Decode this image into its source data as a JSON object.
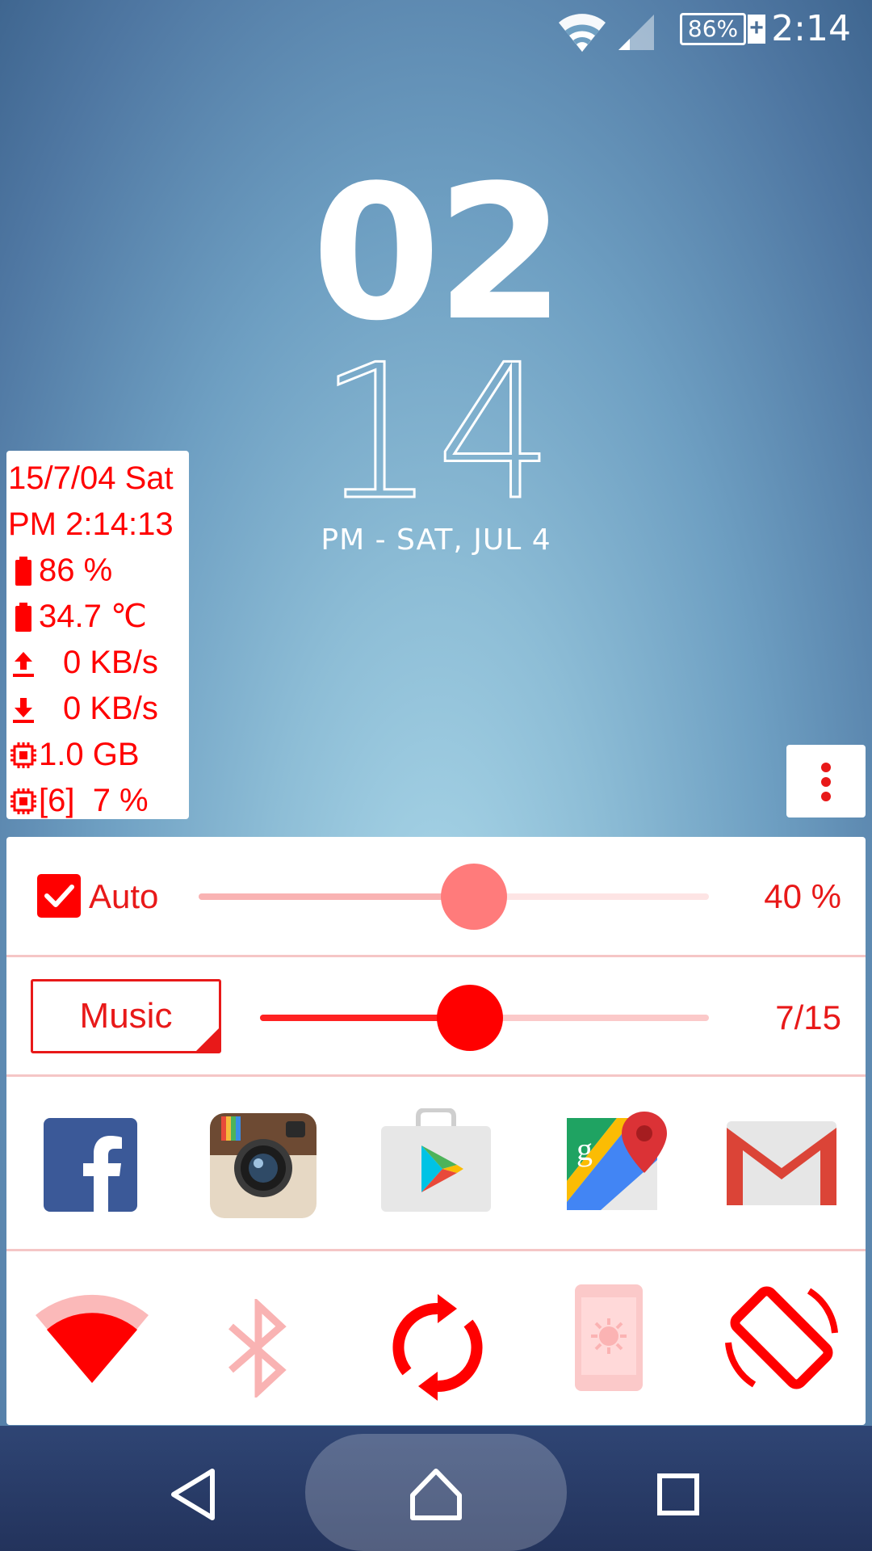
{
  "status_bar": {
    "time": "2:14",
    "battery_percent": "86%",
    "battery_plus": "+",
    "icons": [
      "wifi-icon",
      "signal-icon",
      "battery-charging-icon"
    ]
  },
  "clock": {
    "hour": "02",
    "minute": "14",
    "date": "PM - SAT, JUL 4"
  },
  "info_widget": {
    "date": "15/7/04 Sat",
    "time": "PM 2:14:13",
    "battery_level": "86 %",
    "battery_temp": "34.7 ℃",
    "upload_speed": "0 KB/s",
    "download_speed": "0 KB/s",
    "memory": "1.0 GB",
    "cpu": "[6]  7 %",
    "icons": [
      "battery-icon",
      "thermometer-battery-icon",
      "upload-icon",
      "download-icon",
      "chip-icon",
      "cpu-icon"
    ]
  },
  "menu_button": {
    "icon": "more-vert-icon"
  },
  "brightness": {
    "auto_label": "Auto",
    "auto_checked": true,
    "value_label": "40 %",
    "level": 0.54
  },
  "volume": {
    "stream_label": "Music",
    "value_label": "7/15",
    "level": 0.467
  },
  "apps": [
    {
      "name": "Facebook",
      "icon": "facebook-icon"
    },
    {
      "name": "Instagram",
      "icon": "instagram-icon"
    },
    {
      "name": "Play Store",
      "icon": "play-store-icon"
    },
    {
      "name": "Maps",
      "icon": "maps-icon"
    },
    {
      "name": "Gmail",
      "icon": "gmail-icon"
    }
  ],
  "toggles": [
    {
      "name": "Wi-Fi",
      "icon": "wifi-toggle-icon",
      "state": "on"
    },
    {
      "name": "Bluetooth",
      "icon": "bluetooth-icon",
      "state": "off"
    },
    {
      "name": "Sync",
      "icon": "sync-icon",
      "state": "on"
    },
    {
      "name": "Screen brightness",
      "icon": "screen-brightness-icon",
      "state": "off"
    },
    {
      "name": "Auto-rotate",
      "icon": "rotate-icon",
      "state": "on"
    }
  ],
  "colors": {
    "accent": "#e81919",
    "accent_light": "#f9b3b3",
    "panel": "#ffffff"
  },
  "navigation": {
    "icons": [
      "back-icon",
      "home-icon",
      "recents-icon"
    ]
  }
}
